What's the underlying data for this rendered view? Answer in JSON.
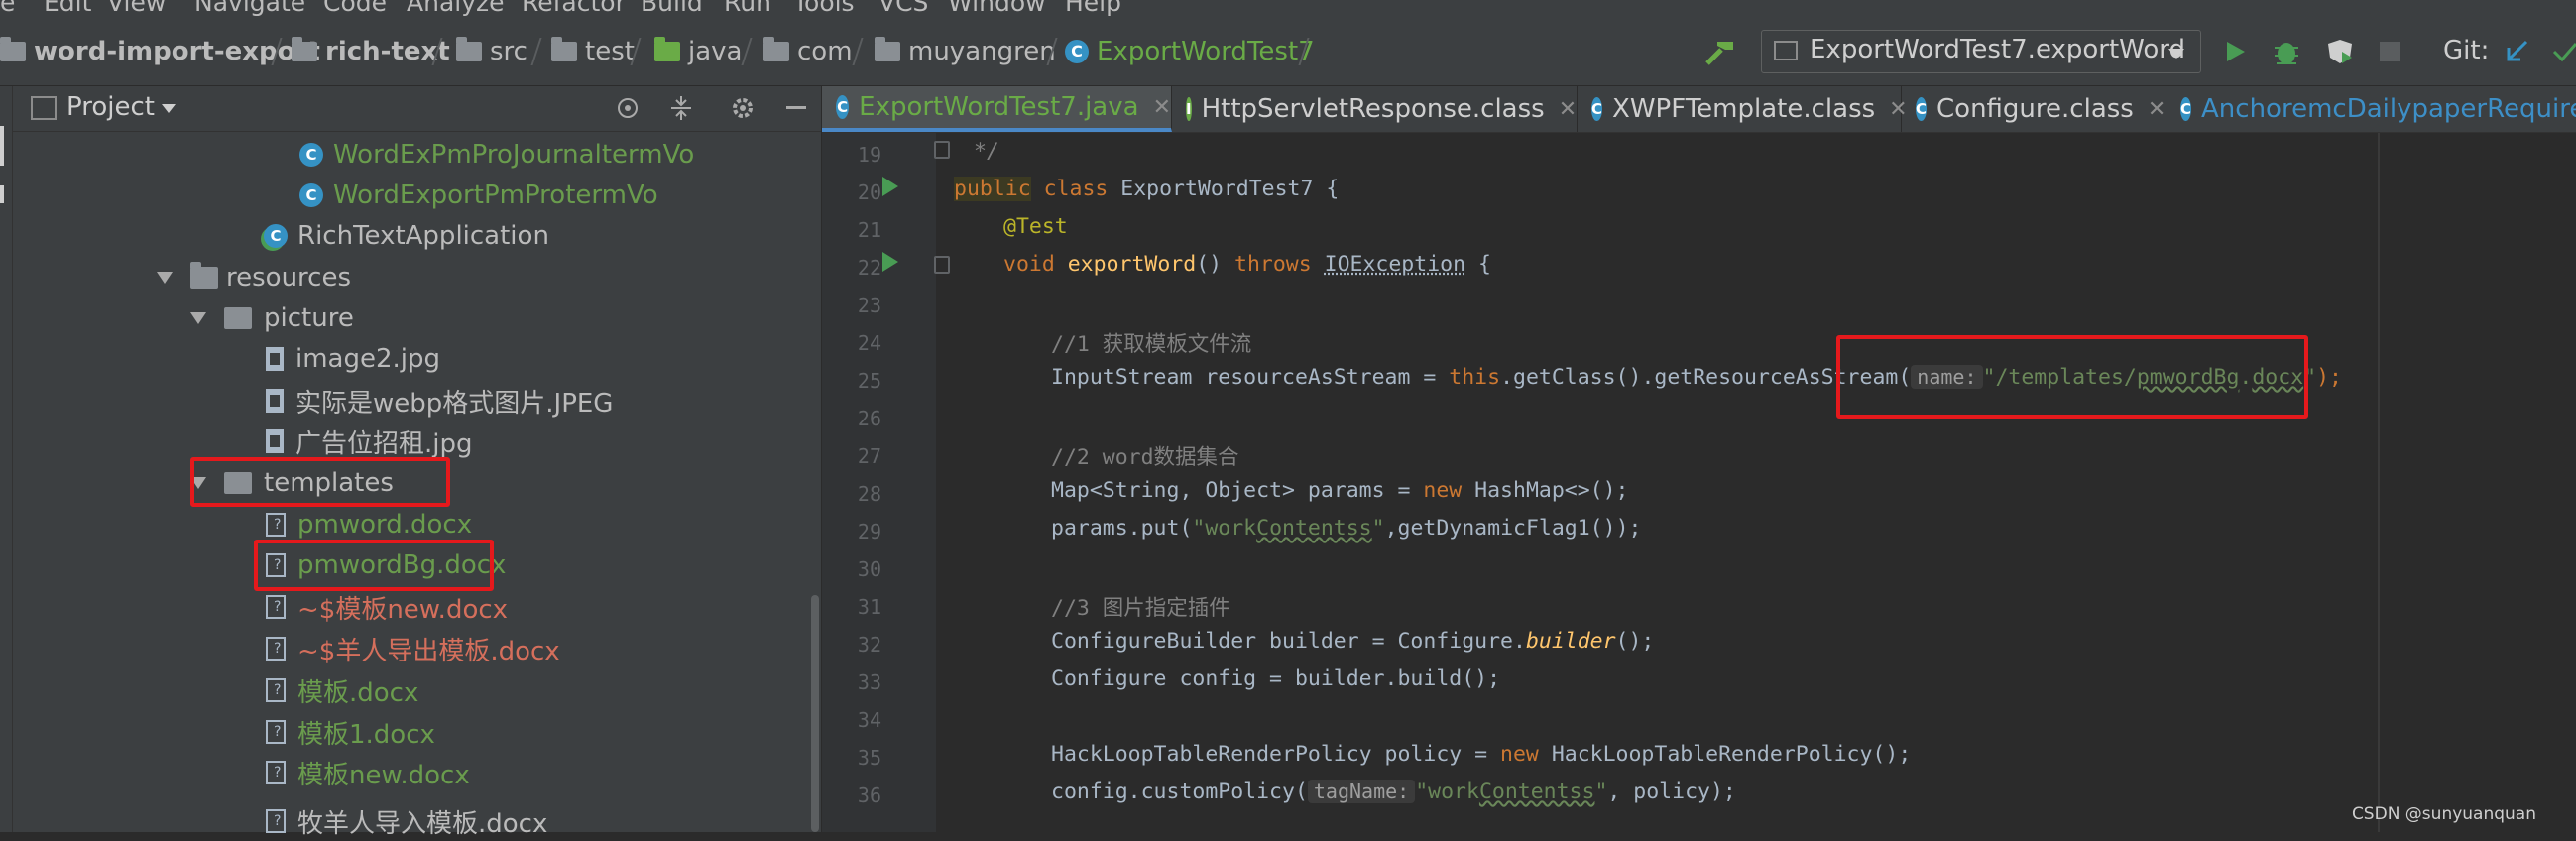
{
  "menu": [
    "e",
    "Edit",
    "View",
    "Navigate",
    "Code",
    "Analyze",
    "Refactor",
    "Build",
    "Run",
    "Tools",
    "VCS",
    "Window",
    "Help"
  ],
  "breadcrumb": [
    "word-import-export",
    "rich-text",
    "src",
    "test",
    "java",
    "com",
    "muyangren",
    "ExportWordTest7"
  ],
  "toolbar": {
    "run_config": "ExportWordTest7.exportWord",
    "git_label": "Git:"
  },
  "project_panel": {
    "title": "Project",
    "items": [
      {
        "label": "WordExPmProJournaltermVo",
        "kind": "class",
        "color": "green"
      },
      {
        "label": "WordExportPmProtermVo",
        "kind": "class",
        "color": "green"
      },
      {
        "label": "RichTextApplication",
        "kind": "app",
        "color": "plain"
      },
      {
        "label": "resources",
        "kind": "folder",
        "color": "plain"
      },
      {
        "label": "picture",
        "kind": "folder",
        "color": "plain"
      },
      {
        "label": "image2.jpg",
        "kind": "image",
        "color": "plain"
      },
      {
        "label": "实际是webp格式图片.JPEG",
        "kind": "image",
        "color": "plain"
      },
      {
        "label": "广告位招租.jpg",
        "kind": "image",
        "color": "plain"
      },
      {
        "label": "templates",
        "kind": "folder",
        "color": "plain"
      },
      {
        "label": "pmword.docx",
        "kind": "word",
        "color": "green"
      },
      {
        "label": "pmwordBg.docx",
        "kind": "word",
        "color": "green"
      },
      {
        "label": "~$模板new.docx",
        "kind": "word",
        "color": "red"
      },
      {
        "label": "~$羊人导出模板.docx",
        "kind": "word",
        "color": "red"
      },
      {
        "label": "模板.docx",
        "kind": "word",
        "color": "green"
      },
      {
        "label": "模板1.docx",
        "kind": "word",
        "color": "green"
      },
      {
        "label": "模板new.docx",
        "kind": "word",
        "color": "green"
      },
      {
        "label": "牧羊人导入模板.docx",
        "kind": "word",
        "color": "plain"
      }
    ]
  },
  "tabs": [
    {
      "label": "ExportWordTest7.java",
      "active": true,
      "icon": "C"
    },
    {
      "label": "HttpServletResponse.class",
      "active": false,
      "icon": "I"
    },
    {
      "label": "XWPFTemplate.class",
      "active": false,
      "icon": "C"
    },
    {
      "label": "Configure.class",
      "active": false,
      "icon": "C"
    },
    {
      "label": "AnchoremcDailypaperRequired",
      "active": false,
      "icon": "C"
    }
  ],
  "line_numbers": [
    "19",
    "20",
    "21",
    "22",
    "23",
    "24",
    "25",
    "26",
    "27",
    "28",
    "29",
    "30",
    "31",
    "32",
    "33",
    "34",
    "35",
    "36"
  ],
  "code": {
    "l19": "*/",
    "l20_public": "public",
    "l20_rest_kw": " class ",
    "l20_rest": "ExportWordTest7 {",
    "l21": "@Test",
    "l22_kw": "void ",
    "l22_fn": "exportWord",
    "l22_mid": "() ",
    "l22_throws": "throws ",
    "l22_exc": "IOException",
    "l22_end": " {",
    "l24": "//1 获取模板文件流",
    "l25_a": "InputStream resourceAsStream = ",
    "l25_this": "this",
    "l25_b": ".getClass().getResourceAsStream(",
    "l25_hint": "name:",
    "l25_str1": "\"/templates/",
    "l25_str2": "pmwordBg",
    "l25_str3": ".",
    "l25_str4": "docx",
    "l25_str5": "\"",
    "l25_end": ");",
    "l27": "//2 word数据集合",
    "l28_a": "Map<String, Object> params = ",
    "l28_new": "new ",
    "l28_b": "HashMap<>();",
    "l29_a": "params.put(",
    "l29_str1": "\"work",
    "l29_str2": "Contentss",
    "l29_str3": "\"",
    "l29_b": ",getDynamicFlag1());",
    "l31": "//3 图片指定插件",
    "l32_a": "ConfigureBuilder builder = Configure.",
    "l32_it": "builder",
    "l32_b": "();",
    "l33": "Configure config = builder.build();",
    "l35_a": "HackLoopTableRenderPolicy policy = ",
    "l35_new": "new ",
    "l35_b": "HackLoopTableRenderPolicy();",
    "l36_a": "config.customPolicy(",
    "l36_hint": "tagName:",
    "l36_str1": "\"work",
    "l36_str2": "Contentss",
    "l36_str3": "\"",
    "l36_b": ", policy);"
  },
  "watermark": "CSDN @sunyuanquan",
  "colors": {
    "highlight_box": "#e5191c",
    "keyword": "#cc7832",
    "string": "#6a8759",
    "vcs_added": "#6aab47"
  }
}
